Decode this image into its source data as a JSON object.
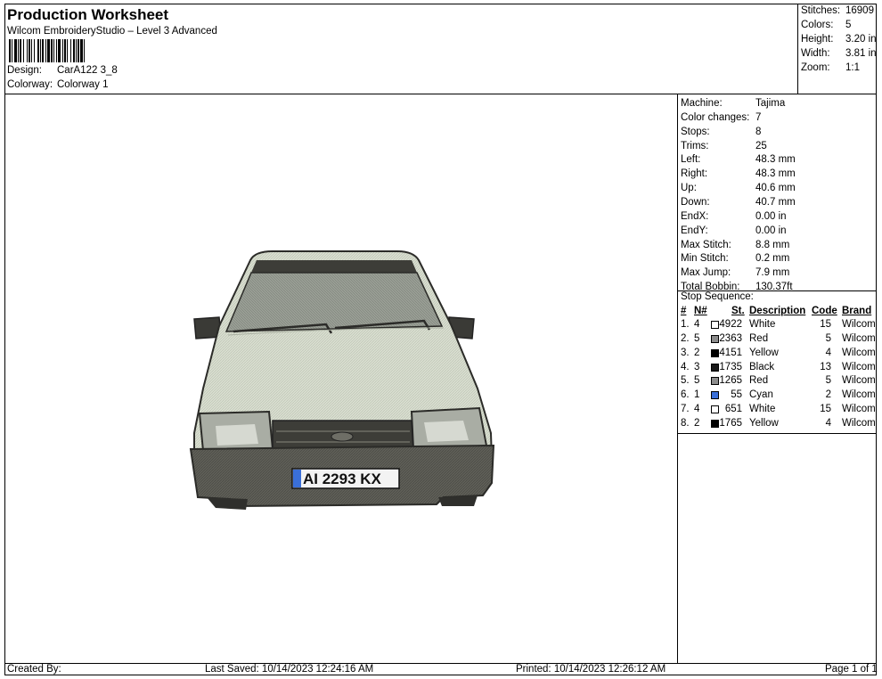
{
  "header": {
    "title": "Production Worksheet",
    "subtitle": "Wilcom EmbroideryStudio – Level 3 Advanced",
    "design_label": "Design:",
    "design_value": "CarA122 3_8",
    "colorway_label": "Colorway:",
    "colorway_value": "Colorway 1"
  },
  "summary": {
    "stitches_label": "Stitches:",
    "stitches": "16909",
    "colors_label": "Colors:",
    "colors": "5",
    "height_label": "Height:",
    "height": "3.20 in",
    "width_label": "Width:",
    "width": "3.81 in",
    "zoom_label": "Zoom:",
    "zoom": "1:1"
  },
  "details": [
    {
      "label": "Machine:",
      "value": "Tajima"
    },
    {
      "label": "Color changes:",
      "value": "7"
    },
    {
      "label": "Stops:",
      "value": "8"
    },
    {
      "label": "Trims:",
      "value": "25"
    },
    {
      "label": "Left:",
      "value": "48.3 mm"
    },
    {
      "label": "Right:",
      "value": "48.3 mm"
    },
    {
      "label": "Up:",
      "value": "40.6 mm"
    },
    {
      "label": "Down:",
      "value": "40.7 mm"
    },
    {
      "label": "EndX:",
      "value": "0.00 in"
    },
    {
      "label": "EndY:",
      "value": "0.00 in"
    },
    {
      "label": "Max Stitch:",
      "value": "8.8 mm"
    },
    {
      "label": "Min Stitch:",
      "value": "0.2 mm"
    },
    {
      "label": "Max Jump:",
      "value": "7.9 mm"
    },
    {
      "label": "Total Bobbin:",
      "value": "130.37ft"
    }
  ],
  "stop_sequence": {
    "title": "Stop Sequence:",
    "headers": {
      "num": "#",
      "n": "N#",
      "st": "St.",
      "desc": "Description",
      "code": "Code",
      "brand": "Brand"
    },
    "rows": [
      {
        "num": "1.",
        "n": "4",
        "st": "4922",
        "desc": "White",
        "code": "15",
        "brand": "Wilcom",
        "color": "#ffffff"
      },
      {
        "num": "2.",
        "n": "5",
        "st": "2363",
        "desc": "Red",
        "code": "5",
        "brand": "Wilcom",
        "color": "#8c8c8c"
      },
      {
        "num": "3.",
        "n": "2",
        "st": "4151",
        "desc": "Yellow",
        "code": "4",
        "brand": "Wilcom",
        "color": "#000000"
      },
      {
        "num": "4.",
        "n": "3",
        "st": "1735",
        "desc": "Black",
        "code": "13",
        "brand": "Wilcom",
        "color": "#1a1a1a"
      },
      {
        "num": "5.",
        "n": "5",
        "st": "1265",
        "desc": "Red",
        "code": "5",
        "brand": "Wilcom",
        "color": "#8c8c8c"
      },
      {
        "num": "6.",
        "n": "1",
        "st": "55",
        "desc": "Cyan",
        "code": "2",
        "brand": "Wilcom",
        "color": "#3a6fd8"
      },
      {
        "num": "7.",
        "n": "4",
        "st": "651",
        "desc": "White",
        "code": "15",
        "brand": "Wilcom",
        "color": "#ffffff"
      },
      {
        "num": "8.",
        "n": "2",
        "st": "1765",
        "desc": "Yellow",
        "code": "4",
        "brand": "Wilcom",
        "color": "#000000"
      }
    ]
  },
  "preview": {
    "plate_text": "AI 2293 KX"
  },
  "footer": {
    "created_by": "Created By:",
    "last_saved": "Last Saved: 10/14/2023 12:24:16 AM",
    "printed": "Printed: 10/14/2023 12:26:12 AM",
    "page": "Page 1 of 1"
  }
}
